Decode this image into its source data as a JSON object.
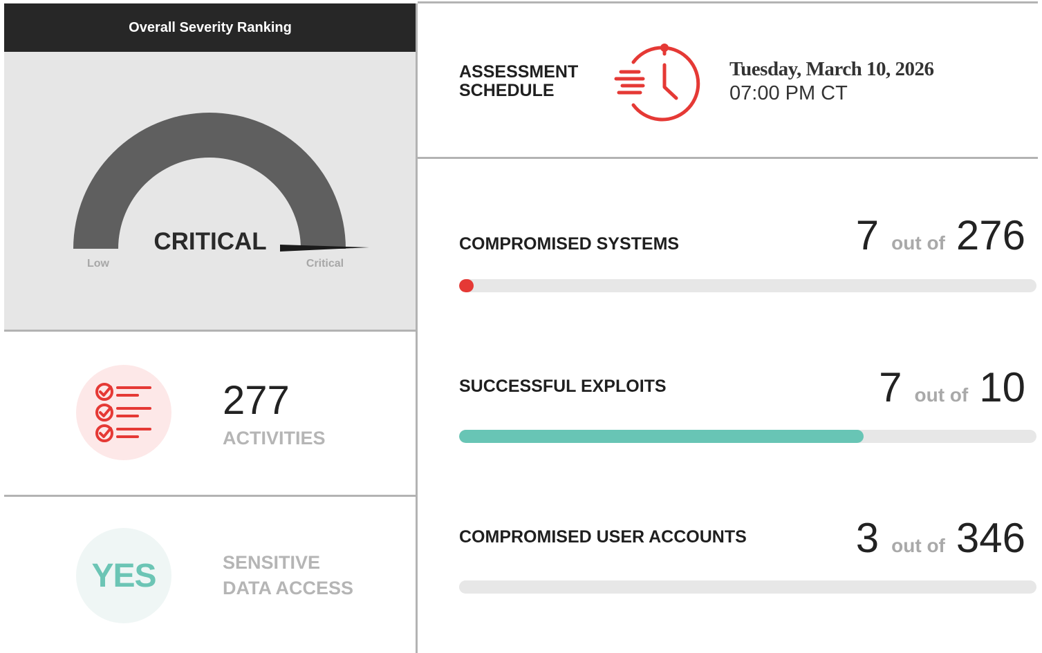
{
  "severity": {
    "header": "Overall Severity Ranking",
    "level_label": "CRITICAL",
    "scale_min_label": "Low",
    "scale_max_label": "Critical",
    "level_fraction": 1.0
  },
  "activities": {
    "count": "277",
    "label": "ACTIVITIES",
    "icon": "checklist-icon"
  },
  "sensitive_data": {
    "value": "YES",
    "label_line1": "SENSITIVE",
    "label_line2": "DATA ACCESS"
  },
  "schedule": {
    "title_line1": "ASSESSMENT",
    "title_line2": "SCHEDULE",
    "date": "Tuesday, March 10, 2026",
    "time": "07:00 PM CT",
    "icon": "stopwatch-icon"
  },
  "metrics": [
    {
      "label": "COMPROMISED SYSTEMS",
      "value": "7",
      "of_text": "out of",
      "total": "276",
      "fraction": 0.0254,
      "color": "#e53935"
    },
    {
      "label": "SUCCESSFUL EXPLOITS",
      "value": "7",
      "of_text": "out of",
      "total": "10",
      "fraction": 0.7,
      "color": "#68c5b5"
    },
    {
      "label": "COMPROMISED USER ACCOUNTS",
      "value": "3",
      "of_text": "out of",
      "total": "346",
      "fraction": 0.0087,
      "color": "#e7e7e7"
    }
  ],
  "colors": {
    "accent_red": "#e53935",
    "accent_teal": "#68c5b5",
    "gauge_gray": "#5f5f5f",
    "header_dark": "#272727",
    "divider": "#b3b3b3"
  }
}
